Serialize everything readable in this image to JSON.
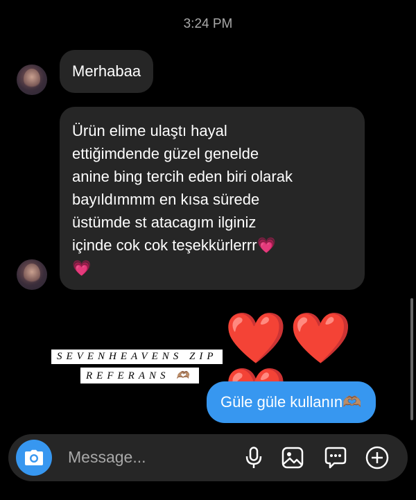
{
  "thread": {
    "timestamp": "3:24 PM",
    "messages": [
      {
        "direction": "incoming",
        "text": "Merhabaa"
      },
      {
        "direction": "incoming",
        "text": "Ürün elime ulaştı hayal ettiğimdende güzel genelde anine bing tercih eden biri olarak bayıldımmm en kısa sürede üstümde st atacagım ilginiz içinde cok cok teşekkürlerrr💗💗"
      },
      {
        "direction": "outgoing",
        "text": "❤️❤️❤️"
      },
      {
        "direction": "outgoing",
        "text": "Güle güle kullanın🫶🏽"
      }
    ],
    "incoming_lines": [
      "Ürün elime ulaştı hayal",
      "ettiğimdende güzel genelde",
      "anine bing tercih eden biri olarak",
      "bayıldımmm en kısa sürede",
      "üstümde st atacagım ilginiz",
      "içinde cok cok teşekkürlerrr💗",
      "💗"
    ]
  },
  "sticker": {
    "line1": "SEVENHEAVENS ZIP",
    "line2": "REFERANS 🫶🏽"
  },
  "composer": {
    "placeholder": "Message...",
    "icons": [
      "camera-icon",
      "microphone-icon",
      "gallery-icon",
      "sticker-chat-icon",
      "plus-circle-icon"
    ]
  },
  "colors": {
    "background": "#000000",
    "incoming_bubble": "#262626",
    "outgoing_bubble": "#3797f0",
    "secondary_text": "#a8a8a8"
  }
}
